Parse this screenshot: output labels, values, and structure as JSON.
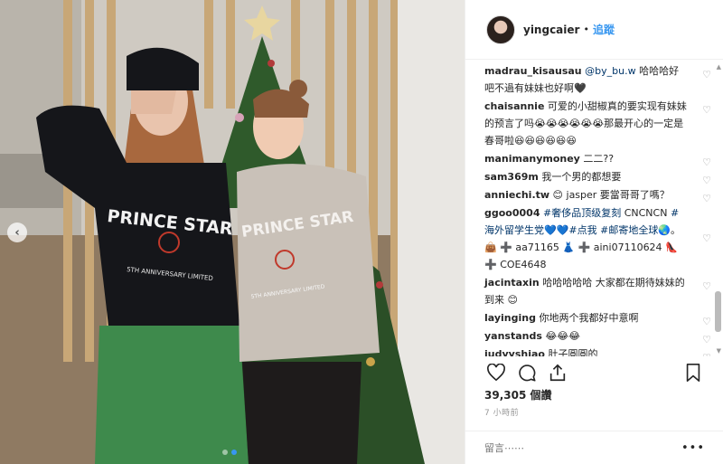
{
  "header": {
    "username": "yingcaier",
    "separator": "•",
    "follow_label": "追蹤"
  },
  "comments": [
    {
      "user": "madrau_kisausau",
      "mention": "@by_bu.w",
      "text": " 哈哈哈好吧不過有妹妹也好啊🖤"
    },
    {
      "user": "chaisannie",
      "text": " 可爱的小甜椒真的要实现有妹妹的预言了吗😭😭😭😭😭😭那最开心的一定是春哥啦😆😆😆😆😆😆"
    },
    {
      "user": "manimanymoney",
      "text": " 二二??"
    },
    {
      "user": "sam369m",
      "text": " 我一个男的都想要"
    },
    {
      "user": "anniechi.tw",
      "text": " 😊 jasper 要當哥哥了嗎？"
    },
    {
      "user": "ggoo0004",
      "tag": "#奢侈品顶级复刻",
      "text": " CNCNCN ",
      "tag2": "#海外留学生党",
      "text2": "💙💙",
      "tag3": "#点我",
      "tag4": "#邮寄地全球",
      "text3": "🌏。👜 ➕ aa71165 ",
      "text4": "👗 ➕ aini07110624 ",
      "text5": "👠 ➕ COE4648"
    },
    {
      "user": "jacintaxin",
      "text": " 哈哈哈哈哈 大家都在期待妹妹的到来 😊"
    },
    {
      "user": "layinging",
      "text": " 你地两个我都好中意啊"
    },
    {
      "user": "yanstands",
      "text": " 😂😂😂"
    },
    {
      "user": "judyyshiao",
      "text": " 肚子圓圓的"
    }
  ],
  "likes": "39,305 個讚",
  "time": "7 小時前",
  "add_comment_placeholder": "留言⋯⋯",
  "more_label": "•••",
  "photo": {
    "sweatshirt_text_left": "PRINCE STAR",
    "sweatshirt_text_right": "PRINCE STAR",
    "sweatshirt_sub": "5TH ANNIVERSARY LIMITED"
  },
  "icons": [
    "heart-icon",
    "comment-icon",
    "share-icon",
    "bookmark-icon",
    "chevron-left-icon"
  ],
  "colors": {
    "accent": "#3897f0",
    "mention": "#003569"
  }
}
